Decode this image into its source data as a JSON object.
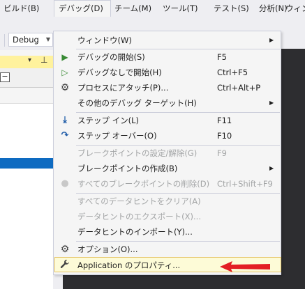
{
  "menubar": {
    "items": [
      "ビルド(B)",
      "デバッグ(D)",
      "チーム(M)",
      "ツール(T)",
      "テスト(S)",
      "分析(N)",
      "ウィンド"
    ]
  },
  "toolbar": {
    "configuration": "Debug"
  },
  "debug_menu": {
    "window": {
      "label": "ウィンドウ(W)"
    },
    "start_debugging": {
      "label": "デバッグの開始(S)",
      "shortcut": "F5"
    },
    "start_without_debugging": {
      "label": "デバッグなしで開始(H)",
      "shortcut": "Ctrl+F5"
    },
    "attach_to_process": {
      "label": "プロセスにアタッチ(P)...",
      "shortcut": "Ctrl+Alt+P"
    },
    "other_debug_targets": {
      "label": "その他のデバッグ ターゲット(H)"
    },
    "step_into": {
      "label": "ステップ イン(L)",
      "shortcut": "F11"
    },
    "step_over": {
      "label": "ステップ オーバー(O)",
      "shortcut": "F10"
    },
    "toggle_breakpoint": {
      "label": "ブレークポイントの設定/解除(G)",
      "shortcut": "F9"
    },
    "new_breakpoint": {
      "label": "ブレークポイントの作成(B)"
    },
    "delete_all_breakpoints": {
      "label": "すべてのブレークポイントの削除(D)",
      "shortcut": "Ctrl+Shift+F9"
    },
    "clear_all_datatips": {
      "label": "すべてのデータヒントをクリア(A)"
    },
    "export_datatips": {
      "label": "データヒントのエクスポート(X)..."
    },
    "import_datatips": {
      "label": "データヒントのインポート(Y)..."
    },
    "options": {
      "label": "オプション(O)..."
    },
    "app_properties": {
      "label": "Application のプロパティ..."
    }
  },
  "colors": {
    "accent_arrow": "#e31e24",
    "highlight_bg": "#fdfbd7",
    "selection_blue": "#0e6bc1",
    "editor_dark": "#2d2d30"
  }
}
